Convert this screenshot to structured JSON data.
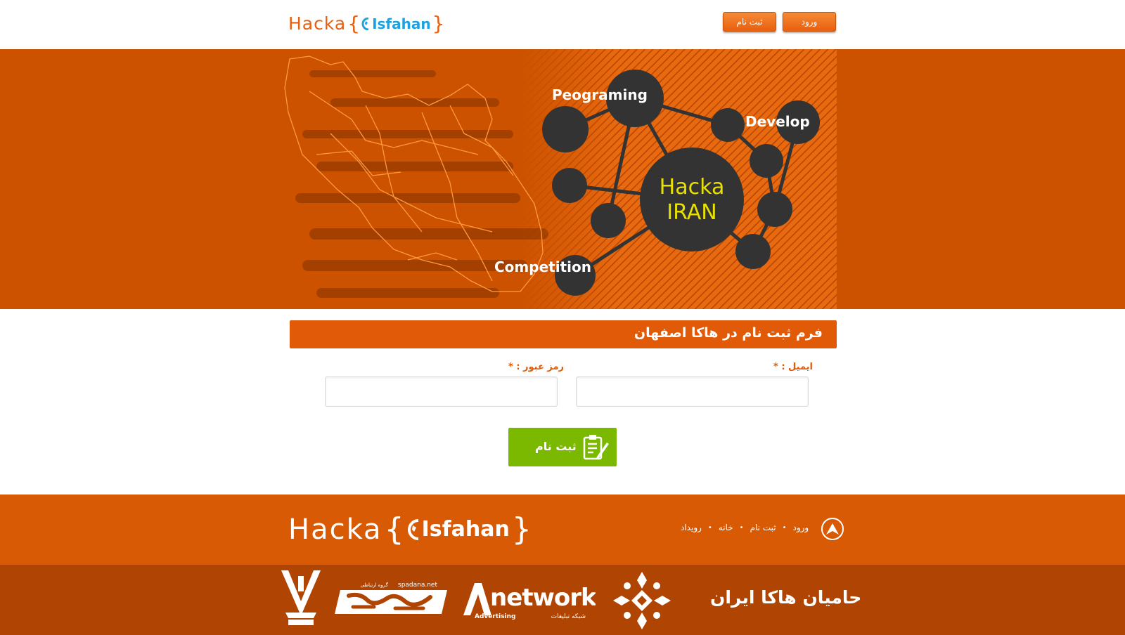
{
  "header": {
    "logo": {
      "hacka": "Hacka",
      "open_brace": "{",
      "city": "Isfahan",
      "close_brace": "}"
    },
    "login_label": "ورود",
    "register_label": "ثبت نام"
  },
  "banner": {
    "labels": {
      "programming": "Peograming",
      "develop": "Develop",
      "competition": "Competition",
      "center_line1": "Hacka",
      "center_line2": "IRAN"
    },
    "colors": {
      "background": "#cc5200",
      "node": "#333333",
      "center_text": "#e8e000"
    }
  },
  "form": {
    "title": "فرم ثبت نام در هاکا اصفهان",
    "email_label": "ایمیل : *",
    "password_label": "رمز عبور : *",
    "email_value": "",
    "password_value": "",
    "submit_label": "ثبت نام"
  },
  "footer": {
    "logo": {
      "hacka": "Hacka",
      "open_brace": "{",
      "city": "Isfahan",
      "close_brace": "}"
    },
    "nav": [
      {
        "label": "ورود"
      },
      {
        "label": "ثبت نام"
      },
      {
        "label": "خانه"
      },
      {
        "label": "رویداد"
      }
    ],
    "sponsors_title": "حامیان هاکا ایران",
    "sponsors": {
      "anetwork": {
        "main": "network",
        "sub": "Advertising",
        "fa": "شبکه تبلیغات"
      },
      "spadana": {
        "site": "spadana.net",
        "fa_small": "گروه ارتباطی"
      }
    }
  },
  "colors": {
    "accent": "#e05a08",
    "submit": "#7bb800",
    "footer_top": "#d95a04",
    "footer_bottom": "#b04503",
    "logo_blue": "#1da1e0"
  }
}
